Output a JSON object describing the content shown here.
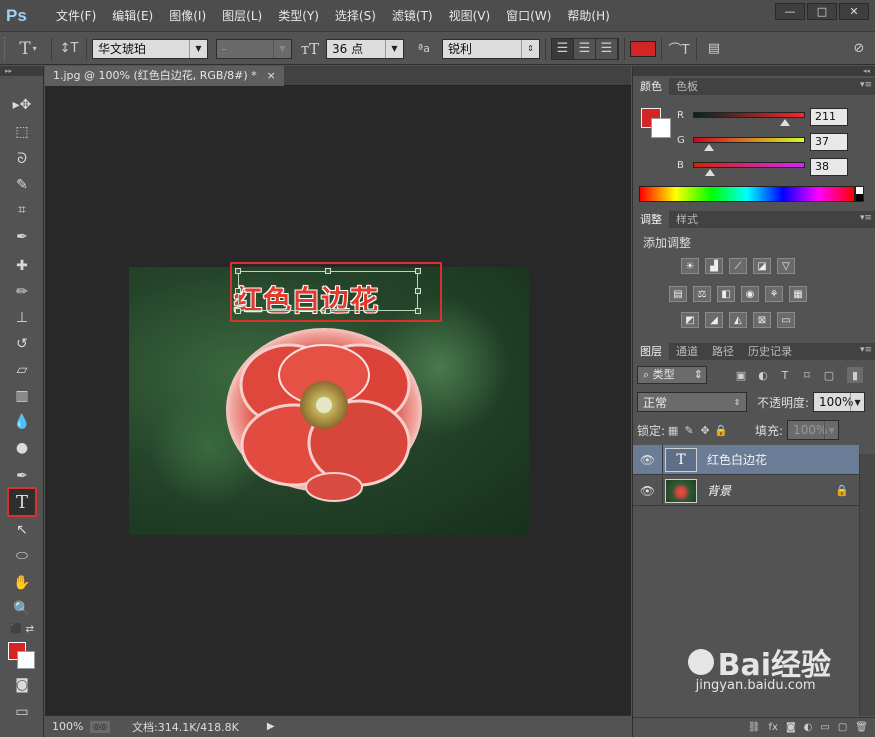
{
  "app": {
    "logo": "Ps"
  },
  "menu": [
    "文件(F)",
    "编辑(E)",
    "图像(I)",
    "图层(L)",
    "类型(Y)",
    "选择(S)",
    "滤镜(T)",
    "视图(V)",
    "窗口(W)",
    "帮助(H)"
  ],
  "options": {
    "font_family": "华文琥珀",
    "font_style": "-",
    "font_size": "36 点",
    "antialias": "锐利",
    "text_color": "#d32525"
  },
  "document": {
    "tab_title": "1.jpg @ 100% (红色白边花, RGB/8#) *",
    "text_layer_content": "红色白边花",
    "status_zoom": "100%",
    "status_doc": "文档:314.1K/418.8K"
  },
  "colors": {
    "foreground": "#d32525",
    "background": "#ffffff"
  },
  "color_panel": {
    "tabs": [
      "颜色",
      "色板"
    ],
    "sliders": [
      {
        "label": "R",
        "value": "211"
      },
      {
        "label": "G",
        "value": "37"
      },
      {
        "label": "B",
        "value": "38"
      }
    ]
  },
  "adjust_panel": {
    "tabs": [
      "调整",
      "样式"
    ],
    "title": "添加调整"
  },
  "layers_panel": {
    "tabs": [
      "图层",
      "通道",
      "路径",
      "历史记录"
    ],
    "filter_type": "类型",
    "blend_mode": "正常",
    "opacity_label": "不透明度:",
    "opacity_value": "100%",
    "lock_label": "锁定:",
    "fill_label": "填充:",
    "fill_value": "100%",
    "layers": [
      {
        "name": "红色白边花",
        "kind": "text",
        "selected": true
      },
      {
        "name": "背景",
        "kind": "image",
        "locked": true
      }
    ]
  },
  "watermark": {
    "text": "Bai经验",
    "sub": "jingyan.baidu.com"
  }
}
